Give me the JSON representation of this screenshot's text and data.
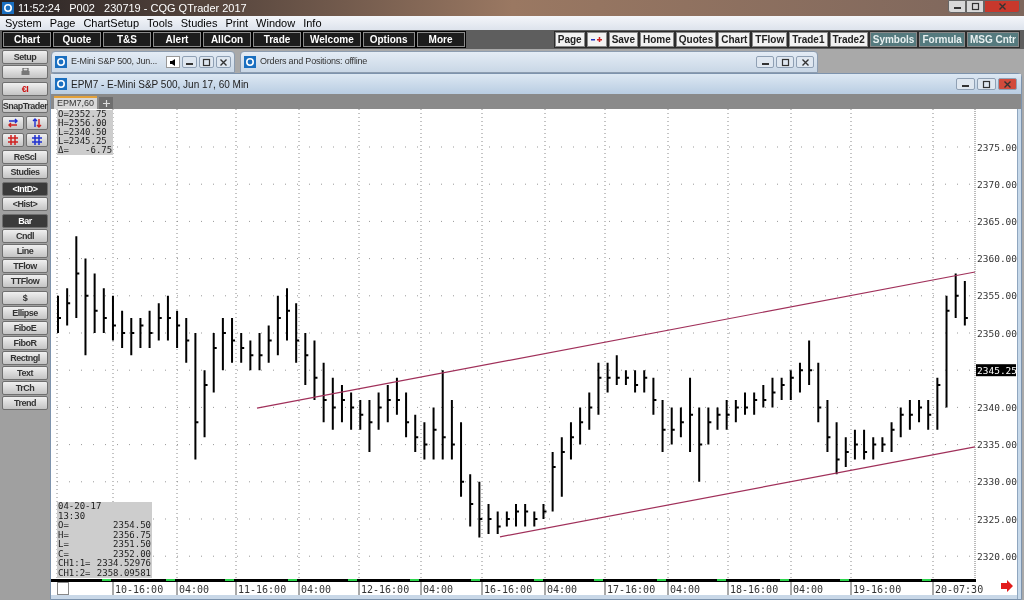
{
  "title_bar": {
    "title": "11:52:24   P002   230719 - CQG QTrader 2017"
  },
  "menu": [
    "System",
    "Page",
    "ChartSetup",
    "Tools",
    "Studies",
    "Print",
    "Window",
    "Info"
  ],
  "toolbar_left": [
    "Chart",
    "Quote",
    "T&S",
    "Alert",
    "AllCon",
    "Trade",
    "Welcome",
    "Options",
    "More"
  ],
  "toolbar_right": [
    {
      "kind": "light",
      "label": "Page"
    },
    {
      "kind": "zoom"
    },
    {
      "kind": "light",
      "label": "Save"
    },
    {
      "kind": "light",
      "label": "Home"
    },
    {
      "kind": "light",
      "label": "Quotes"
    },
    {
      "kind": "light",
      "label": "Chart"
    },
    {
      "kind": "light",
      "label": "TFlow"
    },
    {
      "kind": "light",
      "label": "Trade1"
    },
    {
      "kind": "light",
      "label": "Trade2"
    },
    {
      "kind": "teal",
      "label": "Symbols"
    },
    {
      "kind": "teal",
      "label": "Formula"
    },
    {
      "kind": "teal",
      "label": "MSG Cntr"
    }
  ],
  "sidebar": {
    "groups": [
      [
        {
          "kind": "button",
          "label": "Setup",
          "selected": false
        },
        {
          "kind": "print"
        }
      ],
      [
        {
          "kind": "button",
          "label": "€I",
          "selected": false,
          "color": "#cc1111"
        }
      ],
      [
        {
          "kind": "button",
          "label": "SnapTrader",
          "selected": false
        }
      ],
      [
        {
          "kind": "arrows"
        }
      ],
      [
        {
          "kind": "hash"
        }
      ],
      [
        {
          "kind": "button",
          "label": "ReScl",
          "selected": false
        },
        {
          "kind": "button",
          "label": "Studies",
          "selected": false
        }
      ],
      [
        {
          "kind": "button",
          "label": "<IntD>",
          "selected": true
        },
        {
          "kind": "button",
          "label": "<Hist>",
          "selected": false
        }
      ],
      [
        {
          "kind": "button",
          "label": "Bar",
          "selected": true
        },
        {
          "kind": "button",
          "label": "Cndl",
          "selected": false
        },
        {
          "kind": "button",
          "label": "Line",
          "selected": false
        },
        {
          "kind": "button",
          "label": "TFlow",
          "selected": false
        },
        {
          "kind": "button",
          "label": "TTFlow",
          "selected": false
        }
      ],
      [
        {
          "kind": "button",
          "label": "$",
          "selected": false
        },
        {
          "kind": "button",
          "label": "Ellipse",
          "selected": false
        },
        {
          "kind": "button",
          "label": "FiboE",
          "selected": false
        },
        {
          "kind": "button",
          "label": "FiboR",
          "selected": false
        },
        {
          "kind": "button",
          "label": "Rectngl",
          "selected": false
        },
        {
          "kind": "button",
          "label": "Text",
          "selected": false
        },
        {
          "kind": "button",
          "label": "TrCh",
          "selected": false
        },
        {
          "kind": "button",
          "label": "Trend",
          "selected": false
        }
      ]
    ]
  },
  "windows": [
    {
      "title": "E-Mini S&P 500, Jun...",
      "sound": true
    },
    {
      "title": "Orders and Positions: offline",
      "sound": false
    }
  ],
  "chart_window": {
    "title": "EPM7 - E-Mini S&P 500, Jun 17, 60 Min",
    "tabs": [
      {
        "label": "EPM7,60",
        "selected": true
      }
    ],
    "info_box": [
      "O=2352.75",
      "H=2356.00",
      "L=2340.50",
      "L=2345.25",
      "Δ=   -6.75"
    ],
    "cursor_box": {
      "date": "04-20-17",
      "time": "13:30",
      "rows": [
        {
          "label": "O=",
          "value": "2354.50"
        },
        {
          "label": "H=",
          "value": "2356.75"
        },
        {
          "label": "L=",
          "value": "2351.50"
        },
        {
          "label": "C=",
          "value": "2352.00"
        },
        {
          "label": "CH1:1=",
          "value": "2334.52976"
        },
        {
          "label": "CH1:2=",
          "value": "2358.09581"
        }
      ]
    },
    "price_axis": [
      "2375.00",
      "2370.00",
      "2365.00",
      "2360.00",
      "2355.00",
      "2350.00",
      "2340.00",
      "2335.00",
      "2330.00",
      "2325.00",
      "2320.00"
    ],
    "last_price": "2345.25",
    "time_axis": [
      "10-16:00",
      "04:00",
      "11-16:00",
      "04:00",
      "12-16:00",
      "04:00",
      "16-16:00",
      "04:00",
      "17-16:00",
      "04:00",
      "18-16:00",
      "04:00",
      "19-16:00",
      "20-07:30"
    ]
  }
}
